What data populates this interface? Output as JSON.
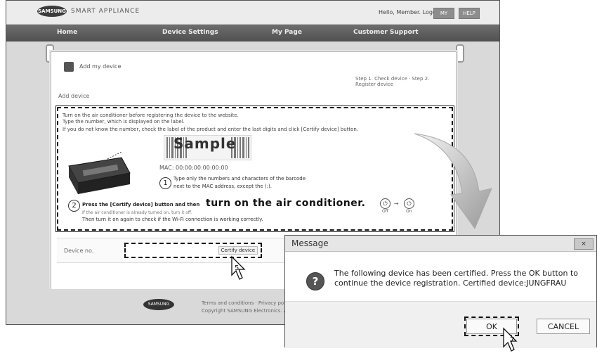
{
  "app": {
    "brand": "SMART APPLIANCE",
    "logo": "SAMSUNG",
    "welcome": "Hello, Member. Logout",
    "top_buttons": [
      "MY",
      "HELP"
    ]
  },
  "nav": {
    "items": [
      "Home",
      "Device Settings",
      "My Page",
      "Customer Support"
    ]
  },
  "card": {
    "title": "Add my device",
    "right_text": "Step 1. Check device · Step 2. Register device",
    "info_line": "Add device",
    "instructions": {
      "line1": "Turn on the air conditioner before registering the device to the website.",
      "line2": "Type the number, which is displayed on the label.",
      "line3": "If you do not know the number, check the label of the product and enter the last digits and click [Certify device] button.",
      "sample": "Sample",
      "mac": "MAC: 00:00:00:00:00:00",
      "step1_num": "1",
      "step1_line1": "Type only the numbers and characters of the barcode",
      "step1_line2": "next to the MAC address, except the (:).",
      "step2_num": "2",
      "step2_a": "Press the [Certify device] button and then",
      "step2_big": "turn on the air conditioner.",
      "step2_b": "If the air conditioner is already turned on, turn it off.",
      "step2_c": "Then turn it on again to check if the Wi-Fi connection is working correctly.",
      "power_label_1": "Off",
      "power_label_2": "On"
    },
    "device_row_label": "Device no.",
    "certify_button": "Certify device"
  },
  "footer": {
    "logo": "SAMSUNG",
    "line1": "Terms and conditions · Privacy policy",
    "line2": "Copyright SAMSUNG Electronics. All rights reserved."
  },
  "cursors": {
    "step5": "5",
    "step7": "7"
  },
  "dialog": {
    "title": "Message",
    "close": "×",
    "icon": "?",
    "message": "The following device has been certified. Press the OK button to continue the device registration. Certified device:JUNGFRAU",
    "ok": "OK",
    "cancel": "CANCEL"
  }
}
